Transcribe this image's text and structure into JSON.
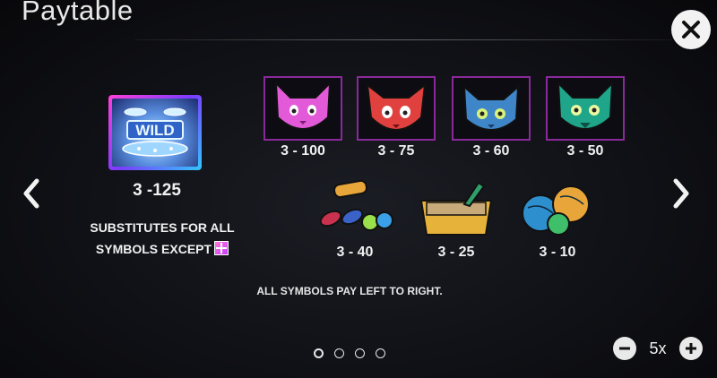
{
  "header": {
    "title": "Paytable"
  },
  "wild": {
    "logo_text": "WILD",
    "payout": "3 -125",
    "desc_line1": "SUBSTITUTES FOR ALL",
    "desc_line2": "SYMBOLS EXCEPT"
  },
  "cats": [
    {
      "icon": "pink-cat-icon",
      "payout": "3 - 100",
      "color": "#e25ad8"
    },
    {
      "icon": "red-cat-icon",
      "payout": "3 - 75",
      "color": "#e0413f"
    },
    {
      "icon": "blue-cat-icon",
      "payout": "3 - 60",
      "color": "#3f86c9"
    },
    {
      "icon": "green-cat-icon",
      "payout": "3 - 50",
      "color": "#1fa58a"
    }
  ],
  "items": [
    {
      "icon": "cat-toys-icon",
      "payout": "3 - 40"
    },
    {
      "icon": "litter-box-icon",
      "payout": "3 - 25"
    },
    {
      "icon": "yarn-balls-icon",
      "payout": "3 - 10"
    }
  ],
  "footnote": "ALL SYMBOLS PAY LEFT TO RIGHT.",
  "zoom": {
    "value": "5x"
  },
  "pagination": {
    "pages": 4,
    "current": 1
  }
}
